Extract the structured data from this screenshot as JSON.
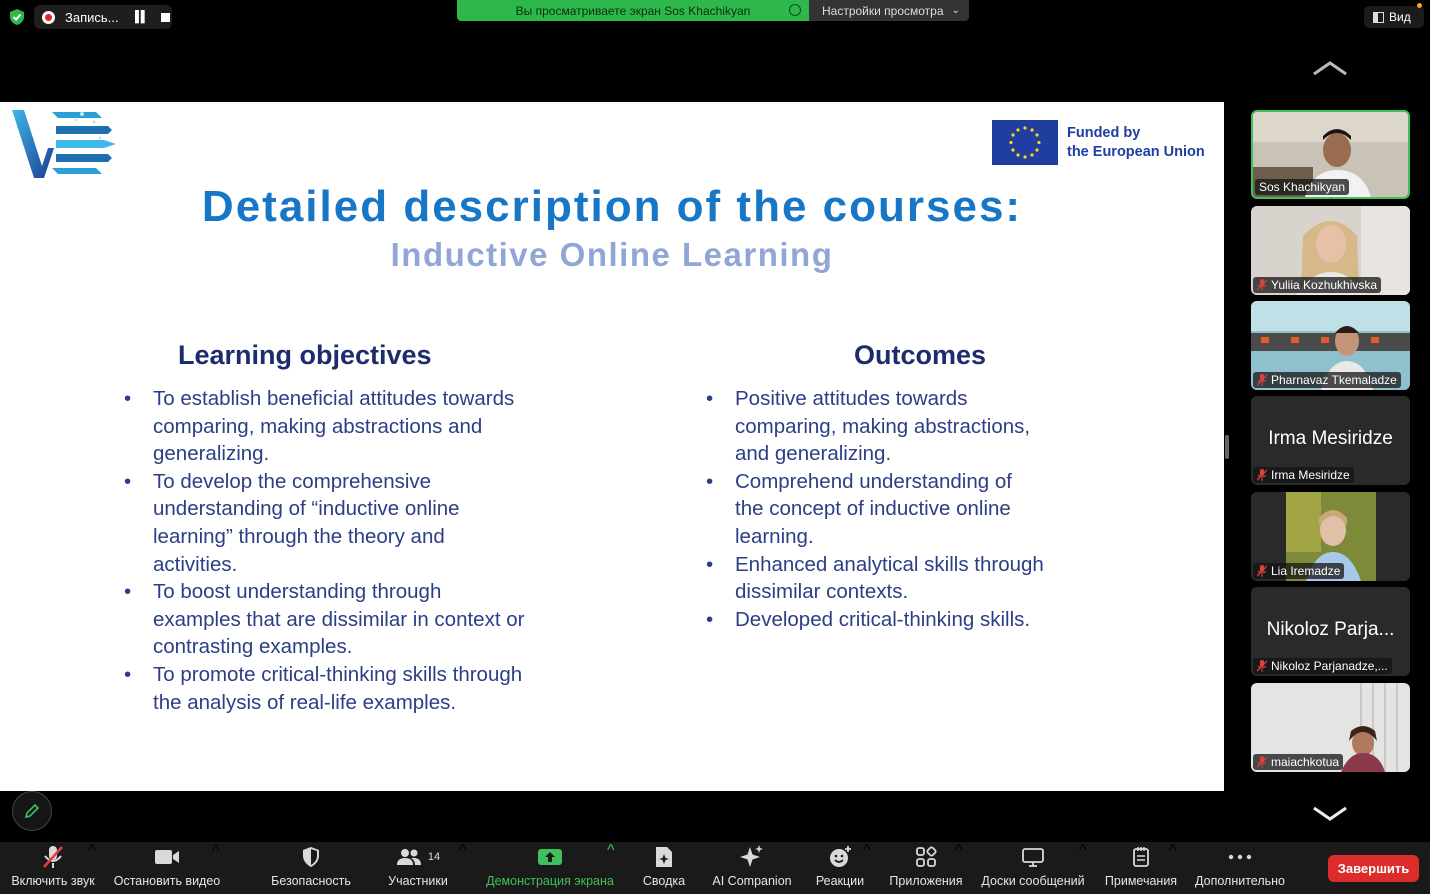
{
  "top": {
    "recording_label": "Запись...",
    "share_banner": "Вы просматриваете экран Sos Khachikyan",
    "view_settings": "Настройки просмотра",
    "view_button": "Вид"
  },
  "slide": {
    "title": "Detailed description of the courses:",
    "subtitle": "Inductive Online Learning",
    "eu_line1": "Funded by",
    "eu_line2": "the European Union",
    "left_heading": "Learning objectives",
    "left_items": [
      "To establish beneficial attitudes towards comparing, making abstractions and generalizing.",
      "To develop the comprehensive understanding of “inductive online learning” through the theory and activities.",
      "To boost understanding through examples that are dissimilar in context or contrasting examples.",
      "To promote critical-thinking skills through the analysis of real-life examples."
    ],
    "right_heading": "Outcomes",
    "right_items": [
      "Positive attitudes towards comparing, making abstractions, and generalizing.",
      "Comprehend understanding of the concept of inductive online learning.",
      "Enhanced analytical skills through dissimilar contexts.",
      "Developed critical-thinking skills."
    ]
  },
  "participants": [
    {
      "name": "Sos Khachikyan",
      "active": true,
      "muted": false
    },
    {
      "name": "Yuliia Kozhukhivska",
      "muted": true
    },
    {
      "name": "Pharnavaz Tkemaladze",
      "muted": true
    },
    {
      "name": "Irma Mesiridze",
      "big": "Irma Mesiridze",
      "muted": true
    },
    {
      "name": "Lia Iremadze",
      "muted": true
    },
    {
      "name": "Nikoloz Parjanadze,...",
      "big": "Nikoloz Parja...",
      "muted": true
    },
    {
      "name": "maiachkotua",
      "muted": true
    }
  ],
  "toolbar": {
    "unmute": "Включить звук",
    "stop_video": "Остановить видео",
    "security": "Безопасность",
    "participants": "Участники",
    "participants_count": "14",
    "share_screen": "Демонстрация экрана",
    "summary": "Сводка",
    "ai_companion": "AI Companion",
    "reactions": "Реакции",
    "apps": "Приложения",
    "whiteboards": "Доски сообщений",
    "notes": "Примечания",
    "more": "Дополнительно",
    "end": "Завершить"
  },
  "colors": {
    "accent_green": "#3ec15a",
    "end_red": "#dc2c2c",
    "slide_title": "#1876c6",
    "slide_text": "#2c3e86"
  }
}
